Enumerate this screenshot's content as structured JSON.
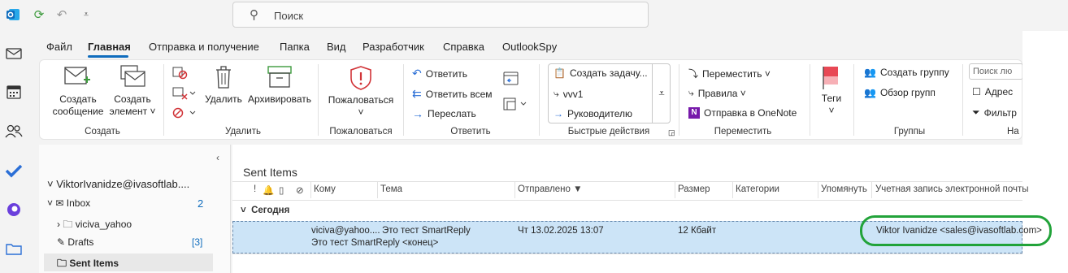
{
  "quick_access": {
    "icons": [
      "outlook-logo-icon",
      "sync-icon",
      "undo-icon",
      "customize-icon"
    ]
  },
  "search": {
    "placeholder": "Поиск"
  },
  "menu_tabs": [
    "Файл",
    "Главная",
    "Отправка и получение",
    "Папка",
    "Вид",
    "Разработчик",
    "Справка",
    "OutlookSpy"
  ],
  "ribbon": {
    "create": {
      "new_message": [
        "Создать",
        "сообщение"
      ],
      "new_item": [
        "Создать",
        "элемент ˅"
      ],
      "label": "Создать"
    },
    "delete": {
      "delete": "Удалить",
      "archive": "Архивировать",
      "label": "Удалить"
    },
    "report": {
      "report": "Пожаловаться",
      "label": "Пожаловаться"
    },
    "respond": {
      "reply": "Ответить",
      "reply_all": "Ответить всем",
      "forward": "Переслать",
      "label": "Ответить"
    },
    "quick_steps": {
      "items": [
        "Создать задачу...",
        "vvv1",
        "Руководителю"
      ],
      "label": "Быстрые действия"
    },
    "move": {
      "move": "Переместить ˅",
      "rules": "Правила ˅",
      "onenote": "Отправка в OneNote",
      "label": "Переместить"
    },
    "tags": {
      "tags": "Теги"
    },
    "groups": {
      "create_group": "Создать группу",
      "browse_groups": "Обзор групп",
      "label": "Группы"
    },
    "find": {
      "search_people": "Поиск лю",
      "address_book": "Адрес",
      "filter": "Фильтр",
      "label": "На"
    }
  },
  "folder_pane": {
    "account": "ViktorIvanidze@ivasoftlab....",
    "folders": [
      {
        "name": "Inbox",
        "count": "2"
      },
      {
        "name": "viciva_yahoo",
        "count": ""
      },
      {
        "name": "Drafts",
        "count": "[3]"
      },
      {
        "name": "Sent Items",
        "count": ""
      }
    ]
  },
  "message_list": {
    "folder_title": "Sent Items",
    "columns": [
      "!",
      "Кому",
      "Тема",
      "Отправлено",
      "Размер",
      "Категории",
      "Упомянуть",
      "Учетная запись электронной почты"
    ],
    "group_header": "Сегодня",
    "rows": [
      {
        "to": "viciva@yahoo....",
        "subject": "Это тест SmartReply",
        "preview": "Это тест SmartReply <конец>",
        "sent": "Чт 13.02.2025 13:07",
        "size": "12 Кбайт",
        "account": "Viktor Ivanidze <sales@ivasoftlab.com>"
      }
    ]
  },
  "colors": {
    "accent": "#0f6cbd",
    "selection": "#cce4f7",
    "highlight_ring": "#22a33a"
  }
}
